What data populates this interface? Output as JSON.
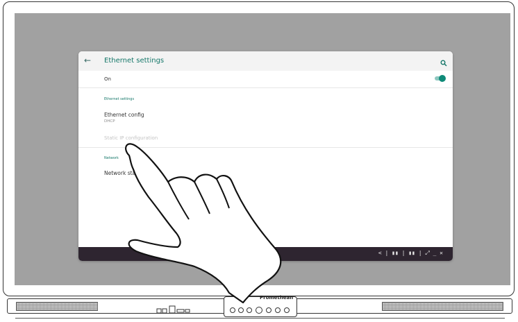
{
  "settings": {
    "back_icon": "arrow-left-icon",
    "title": "Ethernet settings",
    "search_icon": "search-icon",
    "on_label": "On",
    "toggle_on": true,
    "accent_color": "#157769",
    "section_ethernet": "Ethernet settings",
    "ethernet_config": "Ethernet config",
    "ethernet_config_value": "DHCP",
    "static_ip": "Static IP configuration",
    "section_network": "Network",
    "network_status": "Network status"
  },
  "navbar": {
    "controls": "< | ▮▮ | ▮▮ | ⤢ _ ✕"
  },
  "bezel": {
    "brand": "Promethean"
  }
}
